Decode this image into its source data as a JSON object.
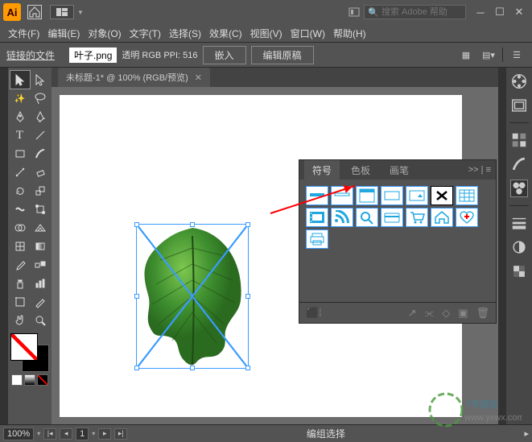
{
  "title": {
    "ai": "Ai"
  },
  "search": {
    "placeholder": "搜索 Adobe 帮助"
  },
  "menus": [
    "文件(F)",
    "编辑(E)",
    "对象(O)",
    "文字(T)",
    "选择(S)",
    "效果(C)",
    "视图(V)",
    "窗口(W)",
    "帮助(H)"
  ],
  "control": {
    "label": "链接的文件",
    "filename": "叶子.png",
    "info": "透明  RGB  PPI: 516",
    "embed": "嵌入",
    "edit": "编辑原稿"
  },
  "tab": {
    "title": "未标题-1* @ 100% (RGB/预览)"
  },
  "panel": {
    "tabs": [
      "符号",
      "色板",
      "画笔"
    ],
    "active": 0,
    "menu": ">> | ≡"
  },
  "status": {
    "zoom": "100%",
    "page": "1",
    "label": "编组选择"
  },
  "watermark": {
    "line1": "7号游戏",
    "line2": "www.yxwx.com"
  }
}
